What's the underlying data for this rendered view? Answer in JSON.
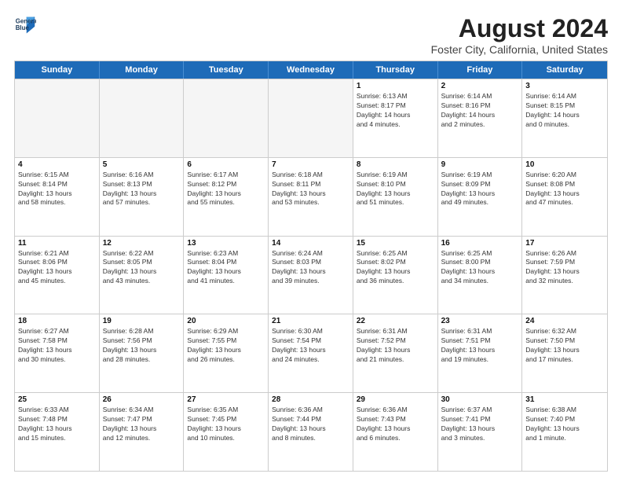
{
  "header": {
    "logo_line1": "General",
    "logo_line2": "Blue",
    "main_title": "August 2024",
    "sub_title": "Foster City, California, United States"
  },
  "days_of_week": [
    "Sunday",
    "Monday",
    "Tuesday",
    "Wednesday",
    "Thursday",
    "Friday",
    "Saturday"
  ],
  "weeks": [
    [
      {
        "day": "",
        "text": "",
        "empty": true
      },
      {
        "day": "",
        "text": "",
        "empty": true
      },
      {
        "day": "",
        "text": "",
        "empty": true
      },
      {
        "day": "",
        "text": "",
        "empty": true
      },
      {
        "day": "1",
        "text": "Sunrise: 6:13 AM\nSunset: 8:17 PM\nDaylight: 14 hours\nand 4 minutes.",
        "empty": false
      },
      {
        "day": "2",
        "text": "Sunrise: 6:14 AM\nSunset: 8:16 PM\nDaylight: 14 hours\nand 2 minutes.",
        "empty": false
      },
      {
        "day": "3",
        "text": "Sunrise: 6:14 AM\nSunset: 8:15 PM\nDaylight: 14 hours\nand 0 minutes.",
        "empty": false
      }
    ],
    [
      {
        "day": "4",
        "text": "Sunrise: 6:15 AM\nSunset: 8:14 PM\nDaylight: 13 hours\nand 58 minutes.",
        "empty": false
      },
      {
        "day": "5",
        "text": "Sunrise: 6:16 AM\nSunset: 8:13 PM\nDaylight: 13 hours\nand 57 minutes.",
        "empty": false
      },
      {
        "day": "6",
        "text": "Sunrise: 6:17 AM\nSunset: 8:12 PM\nDaylight: 13 hours\nand 55 minutes.",
        "empty": false
      },
      {
        "day": "7",
        "text": "Sunrise: 6:18 AM\nSunset: 8:11 PM\nDaylight: 13 hours\nand 53 minutes.",
        "empty": false
      },
      {
        "day": "8",
        "text": "Sunrise: 6:19 AM\nSunset: 8:10 PM\nDaylight: 13 hours\nand 51 minutes.",
        "empty": false
      },
      {
        "day": "9",
        "text": "Sunrise: 6:19 AM\nSunset: 8:09 PM\nDaylight: 13 hours\nand 49 minutes.",
        "empty": false
      },
      {
        "day": "10",
        "text": "Sunrise: 6:20 AM\nSunset: 8:08 PM\nDaylight: 13 hours\nand 47 minutes.",
        "empty": false
      }
    ],
    [
      {
        "day": "11",
        "text": "Sunrise: 6:21 AM\nSunset: 8:06 PM\nDaylight: 13 hours\nand 45 minutes.",
        "empty": false
      },
      {
        "day": "12",
        "text": "Sunrise: 6:22 AM\nSunset: 8:05 PM\nDaylight: 13 hours\nand 43 minutes.",
        "empty": false
      },
      {
        "day": "13",
        "text": "Sunrise: 6:23 AM\nSunset: 8:04 PM\nDaylight: 13 hours\nand 41 minutes.",
        "empty": false
      },
      {
        "day": "14",
        "text": "Sunrise: 6:24 AM\nSunset: 8:03 PM\nDaylight: 13 hours\nand 39 minutes.",
        "empty": false
      },
      {
        "day": "15",
        "text": "Sunrise: 6:25 AM\nSunset: 8:02 PM\nDaylight: 13 hours\nand 36 minutes.",
        "empty": false
      },
      {
        "day": "16",
        "text": "Sunrise: 6:25 AM\nSunset: 8:00 PM\nDaylight: 13 hours\nand 34 minutes.",
        "empty": false
      },
      {
        "day": "17",
        "text": "Sunrise: 6:26 AM\nSunset: 7:59 PM\nDaylight: 13 hours\nand 32 minutes.",
        "empty": false
      }
    ],
    [
      {
        "day": "18",
        "text": "Sunrise: 6:27 AM\nSunset: 7:58 PM\nDaylight: 13 hours\nand 30 minutes.",
        "empty": false
      },
      {
        "day": "19",
        "text": "Sunrise: 6:28 AM\nSunset: 7:56 PM\nDaylight: 13 hours\nand 28 minutes.",
        "empty": false
      },
      {
        "day": "20",
        "text": "Sunrise: 6:29 AM\nSunset: 7:55 PM\nDaylight: 13 hours\nand 26 minutes.",
        "empty": false
      },
      {
        "day": "21",
        "text": "Sunrise: 6:30 AM\nSunset: 7:54 PM\nDaylight: 13 hours\nand 24 minutes.",
        "empty": false
      },
      {
        "day": "22",
        "text": "Sunrise: 6:31 AM\nSunset: 7:52 PM\nDaylight: 13 hours\nand 21 minutes.",
        "empty": false
      },
      {
        "day": "23",
        "text": "Sunrise: 6:31 AM\nSunset: 7:51 PM\nDaylight: 13 hours\nand 19 minutes.",
        "empty": false
      },
      {
        "day": "24",
        "text": "Sunrise: 6:32 AM\nSunset: 7:50 PM\nDaylight: 13 hours\nand 17 minutes.",
        "empty": false
      }
    ],
    [
      {
        "day": "25",
        "text": "Sunrise: 6:33 AM\nSunset: 7:48 PM\nDaylight: 13 hours\nand 15 minutes.",
        "empty": false
      },
      {
        "day": "26",
        "text": "Sunrise: 6:34 AM\nSunset: 7:47 PM\nDaylight: 13 hours\nand 12 minutes.",
        "empty": false
      },
      {
        "day": "27",
        "text": "Sunrise: 6:35 AM\nSunset: 7:45 PM\nDaylight: 13 hours\nand 10 minutes.",
        "empty": false
      },
      {
        "day": "28",
        "text": "Sunrise: 6:36 AM\nSunset: 7:44 PM\nDaylight: 13 hours\nand 8 minutes.",
        "empty": false
      },
      {
        "day": "29",
        "text": "Sunrise: 6:36 AM\nSunset: 7:43 PM\nDaylight: 13 hours\nand 6 minutes.",
        "empty": false
      },
      {
        "day": "30",
        "text": "Sunrise: 6:37 AM\nSunset: 7:41 PM\nDaylight: 13 hours\nand 3 minutes.",
        "empty": false
      },
      {
        "day": "31",
        "text": "Sunrise: 6:38 AM\nSunset: 7:40 PM\nDaylight: 13 hours\nand 1 minute.",
        "empty": false
      }
    ]
  ]
}
